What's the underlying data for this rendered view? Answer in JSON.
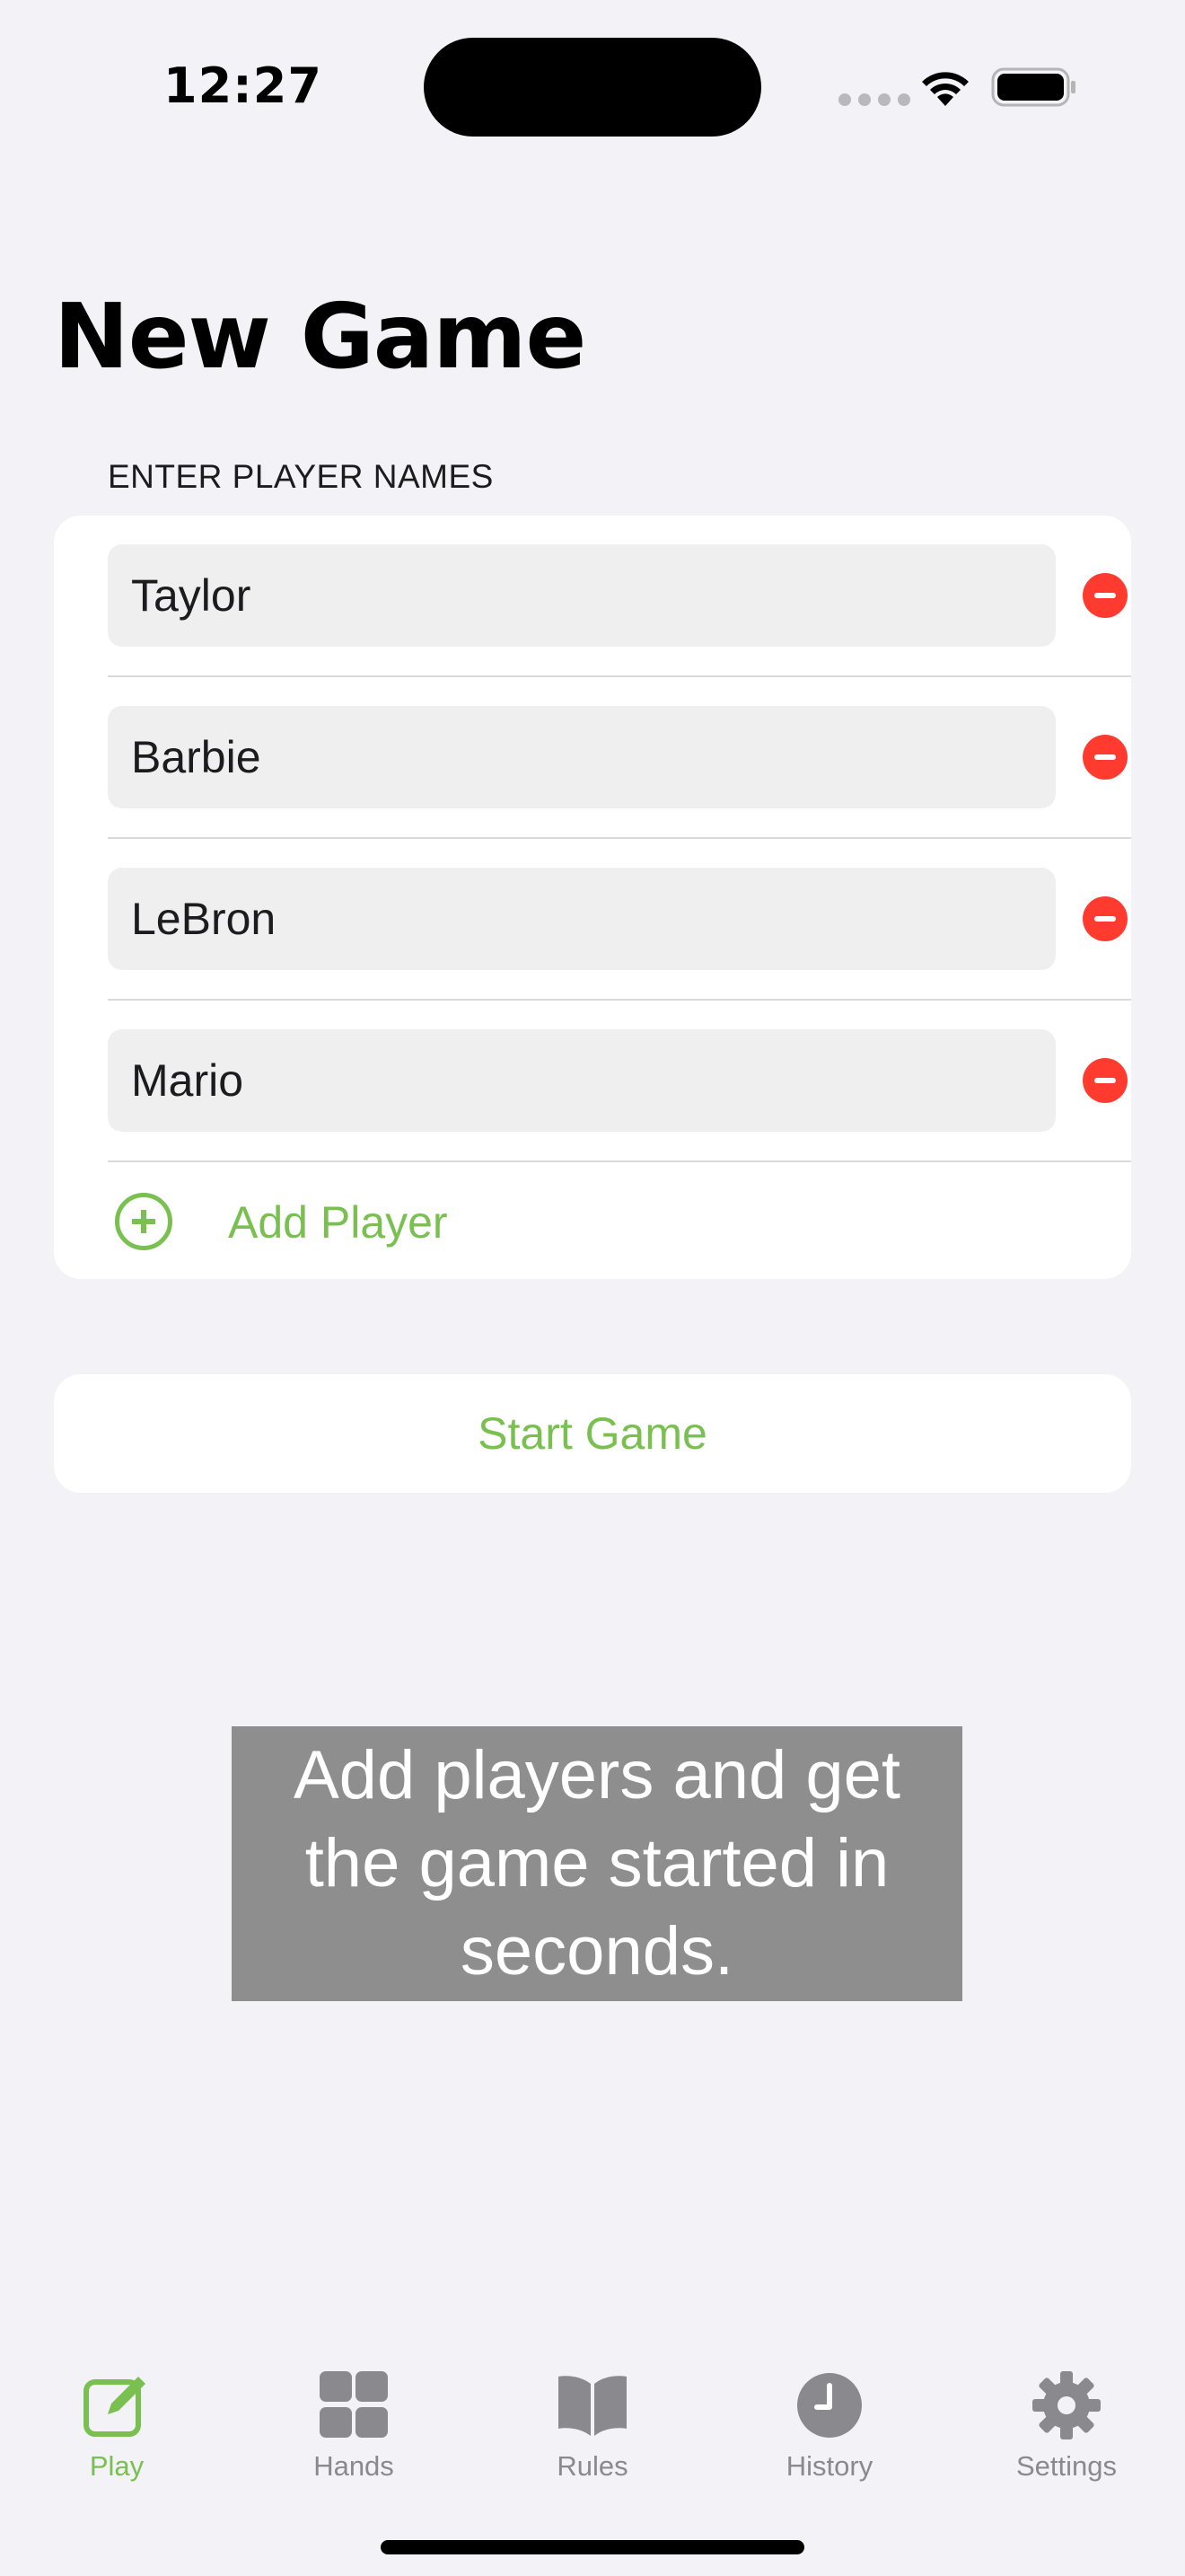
{
  "status_bar": {
    "time": "12:27"
  },
  "page": {
    "title": "New Game"
  },
  "players_section": {
    "header": "ENTER PLAYER NAMES",
    "players": [
      {
        "name": "Taylor"
      },
      {
        "name": "Barbie"
      },
      {
        "name": "LeBron"
      },
      {
        "name": "Mario"
      }
    ],
    "add_player_label": "Add Player"
  },
  "start_button_label": "Start Game",
  "caption": "Add players and get the game started in seconds.",
  "tab_bar": {
    "tabs": [
      {
        "label": "Play",
        "icon": "compose-icon",
        "active": true
      },
      {
        "label": "Hands",
        "icon": "grid-icon",
        "active": false
      },
      {
        "label": "Rules",
        "icon": "book-icon",
        "active": false
      },
      {
        "label": "History",
        "icon": "clock-icon",
        "active": false
      },
      {
        "label": "Settings",
        "icon": "gear-icon",
        "active": false
      }
    ]
  },
  "colors": {
    "accent": "#7ac051",
    "remove": "#ff3b30",
    "background": "#f2f2f7",
    "inactive_tab": "#8a8a8e"
  }
}
